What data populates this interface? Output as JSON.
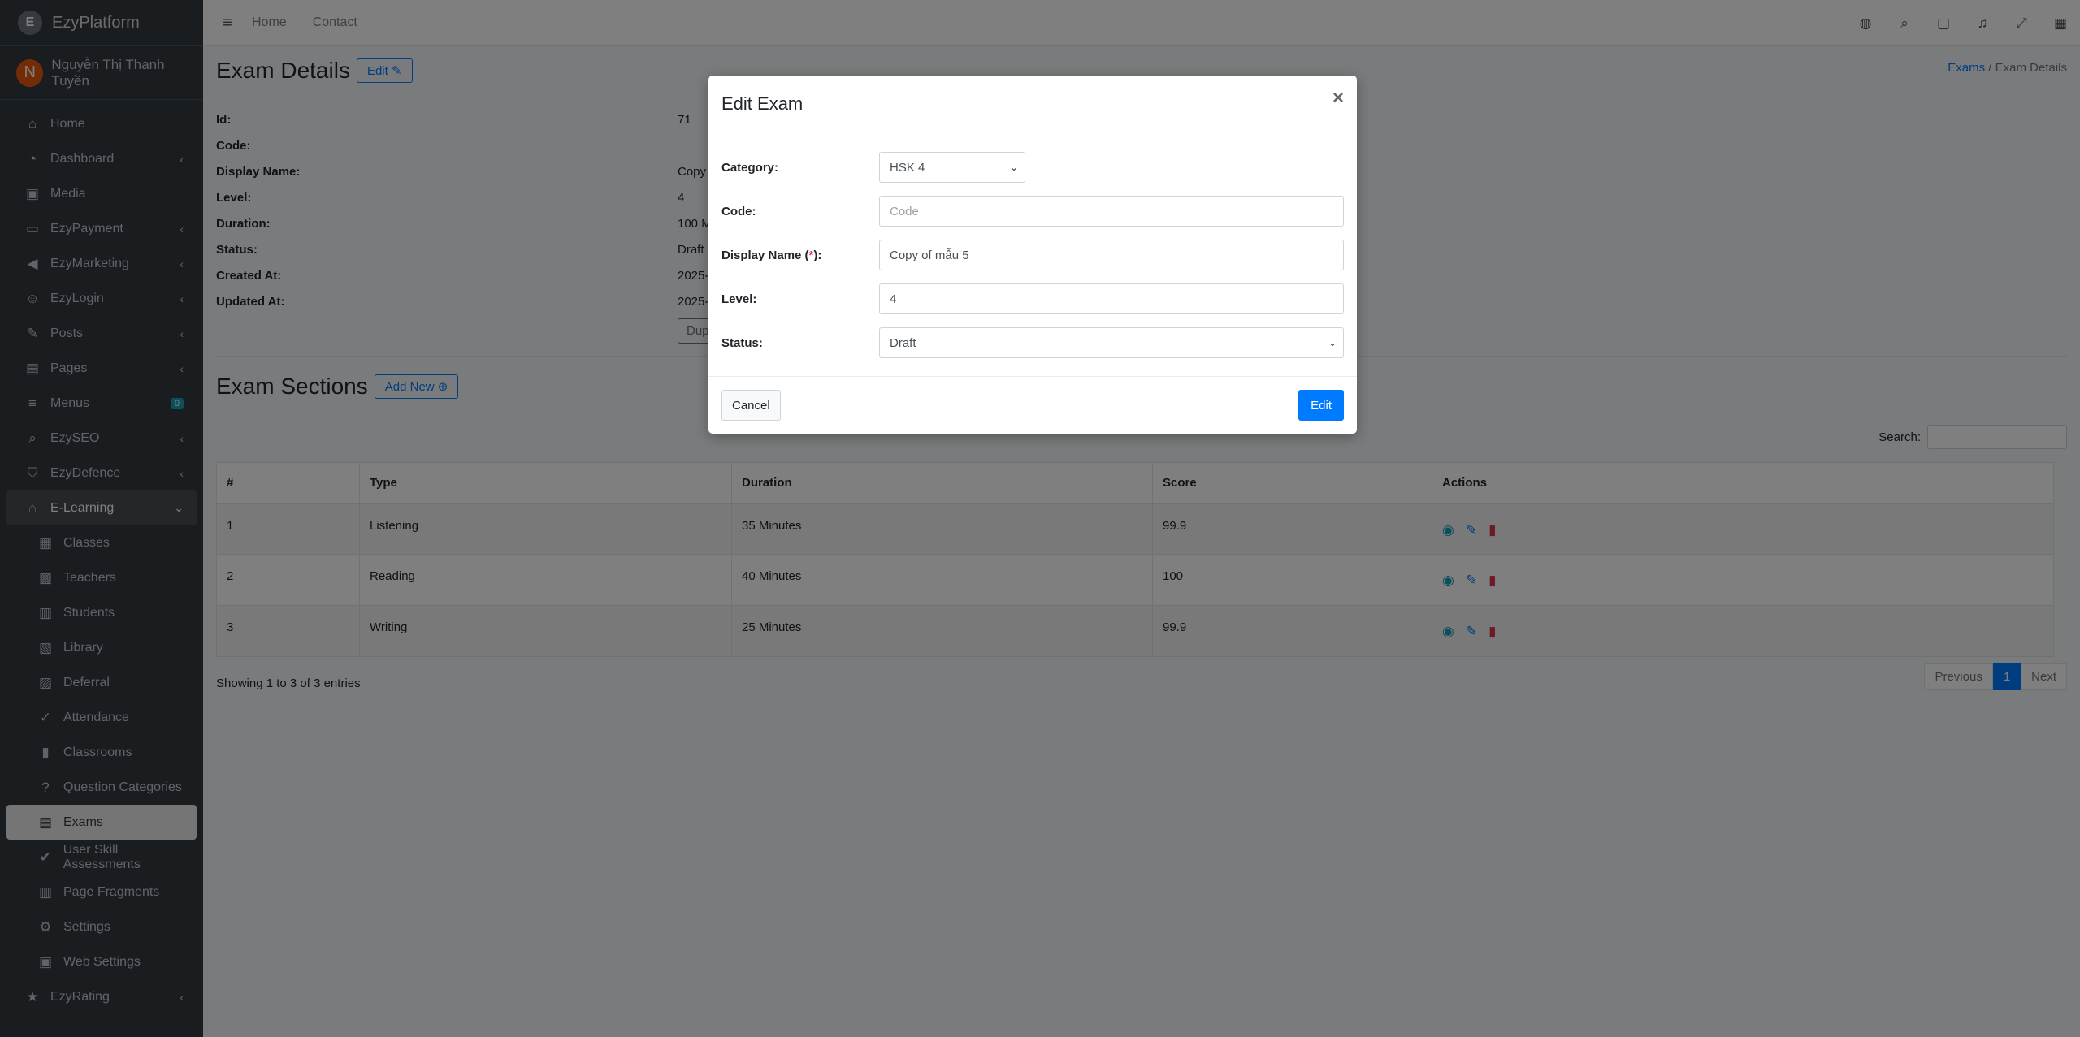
{
  "brand": {
    "name": "EzyPlatform",
    "logo_letter": "E"
  },
  "user": {
    "initial": "N",
    "name": "Nguyễn Thị Thanh Tuyền"
  },
  "sidebar": {
    "items": [
      {
        "label": "Home",
        "icon": "home-icon"
      },
      {
        "label": "Dashboard",
        "icon": "dashboard-icon"
      },
      {
        "label": "Media",
        "icon": "media-icon"
      },
      {
        "label": "EzyPayment",
        "icon": "payment-icon"
      },
      {
        "label": "EzyMarketing",
        "icon": "megaphone-icon"
      },
      {
        "label": "EzyLogin",
        "icon": "login-icon"
      },
      {
        "label": "Posts",
        "icon": "posts-icon"
      },
      {
        "label": "Pages",
        "icon": "pages-icon"
      },
      {
        "label": "Menus",
        "icon": "menu-icon",
        "badge": "0"
      },
      {
        "label": "EzySEO",
        "icon": "seo-icon"
      },
      {
        "label": "EzyDefence",
        "icon": "shield-icon"
      },
      {
        "label": "E-Learning",
        "icon": "graduation-icon"
      },
      {
        "label": "Classes",
        "icon": "classes-icon"
      },
      {
        "label": "Teachers",
        "icon": "teacher-icon"
      },
      {
        "label": "Students",
        "icon": "students-icon"
      },
      {
        "label": "Library",
        "icon": "library-icon"
      },
      {
        "label": "Deferral",
        "icon": "deferral-icon"
      },
      {
        "label": "Attendance",
        "icon": "attendance-icon"
      },
      {
        "label": "Classrooms",
        "icon": "classrooms-icon"
      },
      {
        "label": "Question Categories",
        "icon": "question-icon"
      },
      {
        "label": "Exams",
        "icon": "exams-icon"
      },
      {
        "label": "User Skill Assessments",
        "icon": "assessment-icon"
      },
      {
        "label": "Page Fragments",
        "icon": "fragments-icon"
      },
      {
        "label": "Settings",
        "icon": "settings-icon"
      },
      {
        "label": "Web Settings",
        "icon": "web-settings-icon"
      },
      {
        "label": "EzyRating",
        "icon": "star-icon"
      }
    ]
  },
  "topbar": {
    "home": "Home",
    "contact": "Contact"
  },
  "page": {
    "title": "Exam Details",
    "edit_label": "Edit",
    "breadcrumb": {
      "parent": "Exams",
      "separator": "/",
      "current": "Exam Details"
    }
  },
  "details": {
    "id_label": "Id:",
    "id_value": "71",
    "code_label": "Code:",
    "code_value": "",
    "display_name_label": "Display Name:",
    "display_name_value": "Copy",
    "level_label": "Level:",
    "level_value": "4",
    "duration_label": "Duration:",
    "duration_value": "100 M",
    "status_label": "Status:",
    "status_value": "Draft",
    "created_label": "Created At:",
    "created_value": "2025-",
    "updated_label": "Updated At:",
    "updated_value": "2025-",
    "duplicate_label": "Dup"
  },
  "sections": {
    "title": "Exam Sections",
    "add_label": "Add New",
    "search_label": "Search:",
    "columns": [
      "#",
      "Type",
      "Duration",
      "Score",
      "Actions"
    ],
    "rows": [
      {
        "num": "1",
        "type": "Listening",
        "duration": "35 Minutes",
        "score": "99.9"
      },
      {
        "num": "2",
        "type": "Reading",
        "duration": "40 Minutes",
        "score": "100"
      },
      {
        "num": "3",
        "type": "Writing",
        "duration": "25 Minutes",
        "score": "99.9"
      }
    ],
    "showing": "Showing 1 to 3 of 3 entries",
    "pager": {
      "prev": "Previous",
      "page": "1",
      "next": "Next"
    }
  },
  "modal": {
    "title": "Edit Exam",
    "close": "×",
    "category_label": "Category:",
    "category_value": "HSK 4",
    "code_label": "Code:",
    "code_placeholder": "Code",
    "display_name_label": "Display Name (",
    "display_name_req": "*",
    "display_name_label_end": "):",
    "display_name_value": "Copy of mẫu 5",
    "level_label": "Level:",
    "level_value": "4",
    "status_label": "Status:",
    "status_value": "Draft",
    "cancel_label": "Cancel",
    "submit_label": "Edit"
  },
  "colors": {
    "primary": "#007bff",
    "sidebar": "#343a40",
    "danger": "#dc3545",
    "info": "#17a2b8"
  }
}
